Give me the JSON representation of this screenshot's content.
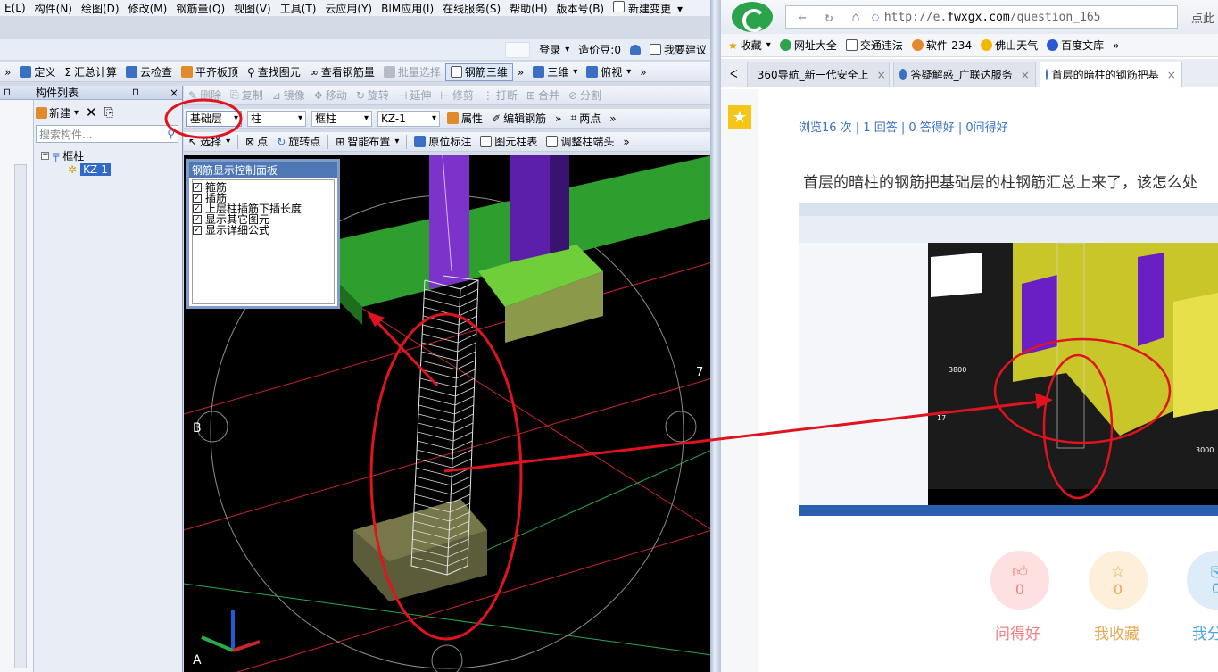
{
  "left_app": {
    "menu": [
      "E(L)",
      "构件(N)",
      "绘图(D)",
      "修改(M)",
      "钢筋量(Q)",
      "视图(V)",
      "工具(T)",
      "云应用(Y)",
      "BIM应用(I)",
      "在线服务(S)",
      "帮助(H)",
      "版本号(B)",
      "新建变更"
    ],
    "account": {
      "login": "登录",
      "beans": "造价豆:0",
      "suggest": "我要建议"
    },
    "toolbar1": {
      "more": "»",
      "define": "定义",
      "sum": "汇总计算",
      "cloud_check": "云检查",
      "flat_board": "平齐板顶",
      "find_element": "查找图元",
      "view_rebar": "查看钢筋量",
      "batch_select": "批量选择",
      "rebar_3d": "钢筋三维",
      "more2": "»",
      "view_3d": "三维",
      "top_view": "俯视",
      "more3": "»"
    },
    "toolbar2": {
      "delete": "删除",
      "copy": "复制",
      "mirror": "镜像",
      "move": "移动",
      "rotate": "旋转",
      "extend": "延伸",
      "trim": "修剪",
      "break": "打断",
      "merge": "合并",
      "split": "分割"
    },
    "toolbar3": {
      "floor": "基础层",
      "category": "柱",
      "type": "框柱",
      "component": "KZ-1",
      "property": "属性",
      "edit_rebar": "编辑钢筋",
      "more": "»",
      "two_point": "两点",
      "more2": "»"
    },
    "toolbar4": {
      "select": "选择",
      "point": "点",
      "rotate_point": "旋转点",
      "smart_layout": "智能布置",
      "origin_label": "原位标注",
      "element_table": "图元柱表",
      "adjust_column_end": "调整柱端头",
      "more": "»"
    },
    "component_panel": {
      "title": "构件列表",
      "new": "新建",
      "search_placeholder": "搜索构件...",
      "tree_root": "框柱",
      "tree_child": "KZ-1"
    },
    "rebar_panel": {
      "title": "钢筋显示控制面板",
      "items": [
        "箍筋",
        "插筋",
        "上层柱插筋下插长度",
        "显示其它图元",
        "显示详细公式"
      ]
    },
    "axis_labels": {
      "b": "B",
      "seven": "7",
      "a": "A"
    }
  },
  "browser": {
    "url_prefix": "http://e.",
    "url_domain": "fwxgx.com",
    "url_rest": "/question_165",
    "extra": "点此",
    "bookmarks": [
      "收藏",
      "网址大全",
      "交通违法",
      "软件-234",
      "佛山天气",
      "百度文库",
      "»"
    ],
    "tabs": [
      {
        "label": "360导航_新一代安全上"
      },
      {
        "label": "答疑解惑_广联达服务"
      },
      {
        "label": "首层的暗柱的钢筋把基"
      }
    ],
    "stats": "浏览16 次 | 1 回答 | 0 答得好 | 0问得好",
    "question_title": "首层的暗柱的钢筋把基础层的柱钢筋汇总上来了，该怎么处",
    "embed_labels": {
      "left_dim": "3800",
      "right_dim": "3000",
      "axis": "17"
    },
    "actions": [
      {
        "label": "问得好",
        "count": "0",
        "color": "#f08080"
      },
      {
        "label": "我收藏",
        "count": "0",
        "color": "#e8a950"
      },
      {
        "label": "我分",
        "count": "0",
        "color": "#4aa3df"
      }
    ]
  }
}
